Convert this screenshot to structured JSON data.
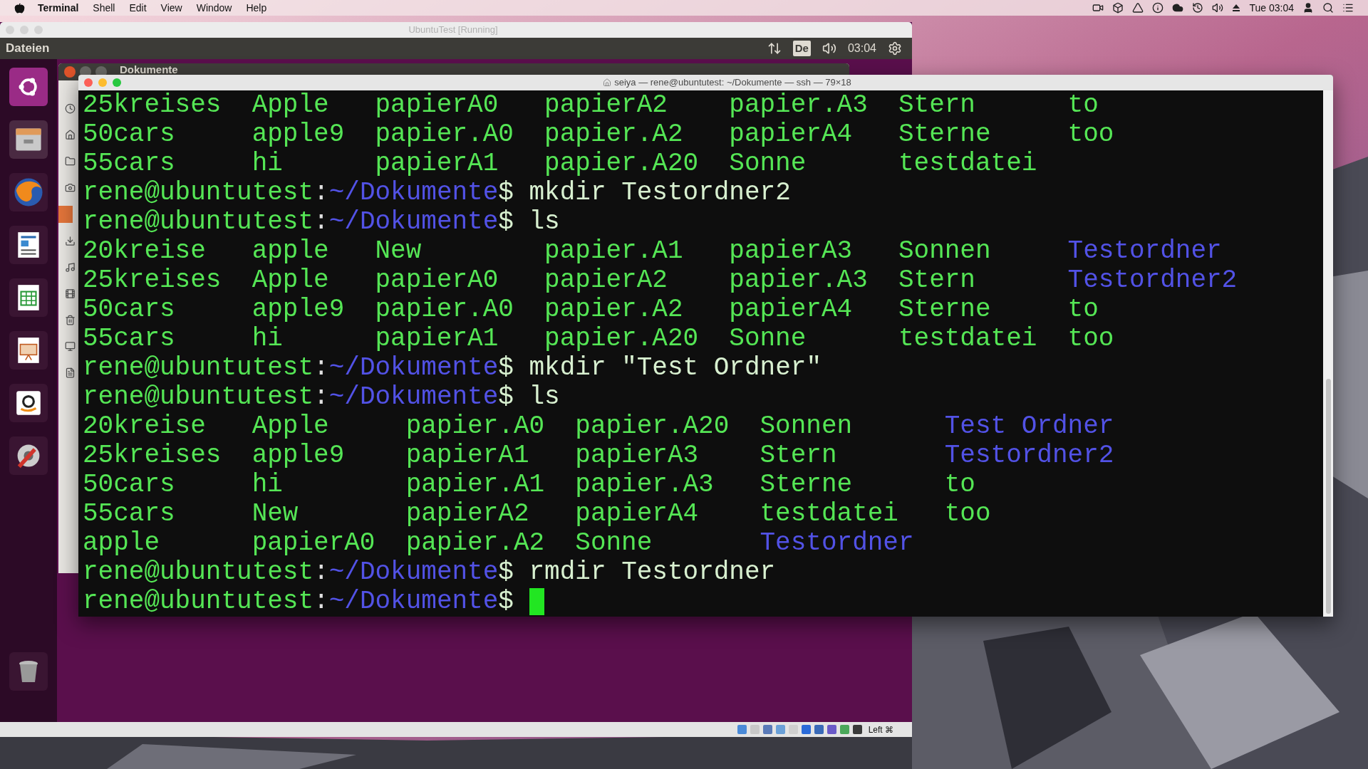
{
  "menubar": {
    "app_name": "Terminal",
    "items": [
      "Shell",
      "Edit",
      "View",
      "Window",
      "Help"
    ],
    "clock": "Tue 03:04"
  },
  "vbox_window": {
    "title": "UbuntuTest [Running]",
    "host_key": "Left ⌘"
  },
  "ubuntu_panel": {
    "title": "Dateien",
    "keyboard": "De",
    "clock": "03:04"
  },
  "files_window": {
    "title": "Dokumente"
  },
  "terminal": {
    "title": "seiya — rene@ubuntutest: ~/Dokumente — ssh — 79×18",
    "blocks": [
      {
        "kind": "listing",
        "rows": [
          [
            {
              "name": "25kreises",
              "kind": "file"
            },
            {
              "name": "Apple",
              "kind": "file"
            },
            {
              "name": "papierA0",
              "kind": "file"
            },
            {
              "name": "papierA2",
              "kind": "file"
            },
            {
              "name": "papier.A3",
              "kind": "file"
            },
            {
              "name": "Stern",
              "kind": "file"
            },
            {
              "name": "to",
              "kind": "file"
            }
          ],
          [
            {
              "name": "50cars",
              "kind": "file"
            },
            {
              "name": "apple9",
              "kind": "file"
            },
            {
              "name": "papier.A0",
              "kind": "file"
            },
            {
              "name": "papier.A2",
              "kind": "file"
            },
            {
              "name": "papierA4",
              "kind": "file"
            },
            {
              "name": "Sterne",
              "kind": "file"
            },
            {
              "name": "too",
              "kind": "file"
            }
          ],
          [
            {
              "name": "55cars",
              "kind": "file"
            },
            {
              "name": "hi",
              "kind": "file"
            },
            {
              "name": "papierA1",
              "kind": "file"
            },
            {
              "name": "papier.A20",
              "kind": "file"
            },
            {
              "name": "Sonne",
              "kind": "file"
            },
            {
              "name": "testdatei",
              "kind": "file"
            }
          ]
        ]
      },
      {
        "kind": "prompt",
        "user": "rene@ubuntutest",
        "separator": ":",
        "path": "~/Dokumente",
        "sign": "$",
        "command": "mkdir Testordner2",
        "cursor": false
      },
      {
        "kind": "prompt",
        "user": "rene@ubuntutest",
        "separator": ":",
        "path": "~/Dokumente",
        "sign": "$",
        "command": "ls",
        "cursor": false
      },
      {
        "kind": "listing",
        "rows": [
          [
            {
              "name": "20kreise",
              "kind": "file"
            },
            {
              "name": "apple",
              "kind": "file"
            },
            {
              "name": "New",
              "kind": "file"
            },
            {
              "name": "papier.A1",
              "kind": "file"
            },
            {
              "name": "papierA3",
              "kind": "file"
            },
            {
              "name": "Sonnen",
              "kind": "file"
            },
            {
              "name": "Testordner",
              "kind": "dir"
            }
          ],
          [
            {
              "name": "25kreises",
              "kind": "file"
            },
            {
              "name": "Apple",
              "kind": "file"
            },
            {
              "name": "papierA0",
              "kind": "file"
            },
            {
              "name": "papierA2",
              "kind": "file"
            },
            {
              "name": "papier.A3",
              "kind": "file"
            },
            {
              "name": "Stern",
              "kind": "file"
            },
            {
              "name": "Testordner2",
              "kind": "dir"
            }
          ],
          [
            {
              "name": "50cars",
              "kind": "file"
            },
            {
              "name": "apple9",
              "kind": "file"
            },
            {
              "name": "papier.A0",
              "kind": "file"
            },
            {
              "name": "papier.A2",
              "kind": "file"
            },
            {
              "name": "papierA4",
              "kind": "file"
            },
            {
              "name": "Sterne",
              "kind": "file"
            },
            {
              "name": "to",
              "kind": "file"
            }
          ],
          [
            {
              "name": "55cars",
              "kind": "file"
            },
            {
              "name": "hi",
              "kind": "file"
            },
            {
              "name": "papierA1",
              "kind": "file"
            },
            {
              "name": "papier.A20",
              "kind": "file"
            },
            {
              "name": "Sonne",
              "kind": "file"
            },
            {
              "name": "testdatei",
              "kind": "file"
            },
            {
              "name": "too",
              "kind": "file"
            }
          ]
        ]
      },
      {
        "kind": "prompt",
        "user": "rene@ubuntutest",
        "separator": ":",
        "path": "~/Dokumente",
        "sign": "$",
        "command": "mkdir \"Test Ordner\"",
        "cursor": false
      },
      {
        "kind": "prompt",
        "user": "rene@ubuntutest",
        "separator": ":",
        "path": "~/Dokumente",
        "sign": "$",
        "command": "ls",
        "cursor": false
      },
      {
        "kind": "listing",
        "rows": [
          [
            {
              "name": "20kreise",
              "kind": "file"
            },
            {
              "name": "Apple",
              "kind": "file"
            },
            {
              "name": "papier.A0",
              "kind": "file"
            },
            {
              "name": "papier.A20",
              "kind": "file"
            },
            {
              "name": "Sonnen",
              "kind": "file"
            },
            {
              "name": "Test Ordner",
              "kind": "dir"
            }
          ],
          [
            {
              "name": "25kreises",
              "kind": "file"
            },
            {
              "name": "apple9",
              "kind": "file"
            },
            {
              "name": "papierA1",
              "kind": "file"
            },
            {
              "name": "papierA3",
              "kind": "file"
            },
            {
              "name": "Stern",
              "kind": "file"
            },
            {
              "name": "Testordner2",
              "kind": "dir"
            }
          ],
          [
            {
              "name": "50cars",
              "kind": "file"
            },
            {
              "name": "hi",
              "kind": "file"
            },
            {
              "name": "papier.A1",
              "kind": "file"
            },
            {
              "name": "papier.A3",
              "kind": "file"
            },
            {
              "name": "Sterne",
              "kind": "file"
            },
            {
              "name": "to",
              "kind": "file"
            }
          ],
          [
            {
              "name": "55cars",
              "kind": "file"
            },
            {
              "name": "New",
              "kind": "file"
            },
            {
              "name": "papierA2",
              "kind": "file"
            },
            {
              "name": "papierA4",
              "kind": "file"
            },
            {
              "name": "testdatei",
              "kind": "file"
            },
            {
              "name": "too",
              "kind": "file"
            }
          ],
          [
            {
              "name": "apple",
              "kind": "file"
            },
            {
              "name": "papierA0",
              "kind": "file"
            },
            {
              "name": "papier.A2",
              "kind": "file"
            },
            {
              "name": "Sonne",
              "kind": "file"
            },
            {
              "name": "Testordner",
              "kind": "dir"
            }
          ]
        ]
      },
      {
        "kind": "prompt",
        "user": "rene@ubuntutest",
        "separator": ":",
        "path": "~/Dokumente",
        "sign": "$",
        "command": "rmdir Testordner",
        "cursor": false
      },
      {
        "kind": "prompt",
        "user": "rene@ubuntutest",
        "separator": ":",
        "path": "~/Dokumente",
        "sign": "$",
        "cursor": true
      }
    ]
  }
}
